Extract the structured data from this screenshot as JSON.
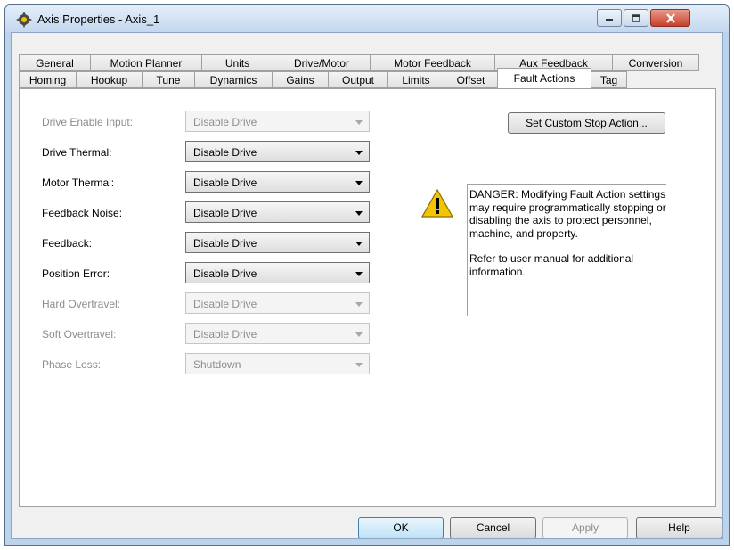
{
  "window": {
    "title": "Axis Properties - Axis_1",
    "icon": "gear-axis-icon",
    "controls": {
      "minimize": "minimize-icon",
      "maximize": "maximize-icon",
      "close": "close-icon"
    }
  },
  "tabs": {
    "back_row": [
      "General",
      "Motion Planner",
      "Units",
      "Drive/Motor",
      "Motor Feedback",
      "Aux Feedback",
      "Conversion"
    ],
    "front_row": [
      "Homing",
      "Hookup",
      "Tune",
      "Dynamics",
      "Gains",
      "Output",
      "Limits",
      "Offset",
      "Fault Actions",
      "Tag"
    ],
    "active": "Fault Actions"
  },
  "fault_actions": [
    {
      "label": "Drive Enable Input:",
      "value": "Disable Drive",
      "enabled": false
    },
    {
      "label": "Drive Thermal:",
      "value": "Disable Drive",
      "enabled": true
    },
    {
      "label": "Motor Thermal:",
      "value": "Disable Drive",
      "enabled": true
    },
    {
      "label": "Feedback Noise:",
      "value": "Disable Drive",
      "enabled": true
    },
    {
      "label": "Feedback:",
      "value": "Disable Drive",
      "enabled": true
    },
    {
      "label": "Position Error:",
      "value": "Disable Drive",
      "enabled": true
    },
    {
      "label": "Hard Overtravel:",
      "value": "Disable Drive",
      "enabled": false
    },
    {
      "label": "Soft Overtravel:",
      "value": "Disable Drive",
      "enabled": false
    },
    {
      "label": "Phase Loss:",
      "value": "Shutdown",
      "enabled": false
    }
  ],
  "custom_stop_button": "Set Custom Stop Action...",
  "danger": {
    "icon": "warning-icon",
    "message": "DANGER: Modifying Fault Action settings may require programmatically stopping or disabling the axis to protect personnel, machine, and property.",
    "note": "Refer to user manual for additional information."
  },
  "buttons": {
    "ok": "OK",
    "cancel": "Cancel",
    "apply": "Apply",
    "help": "Help"
  },
  "colors": {
    "title_bar": "#c3d7ef",
    "close_button": "#c8402c",
    "disabled_text": "#8d8d8d",
    "warning": "#f5c400"
  }
}
